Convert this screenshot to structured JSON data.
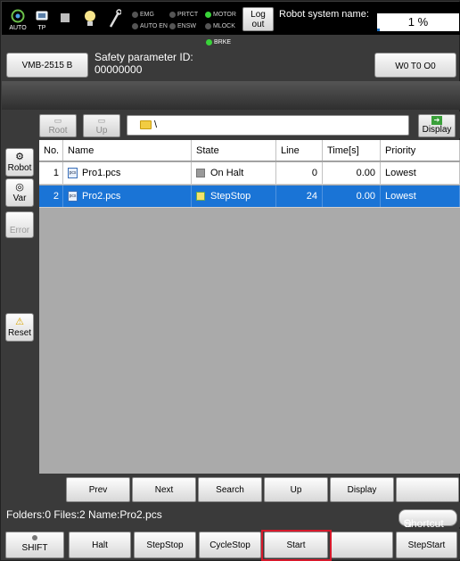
{
  "topbar": {
    "auto_label": "AUTO",
    "tp_label": "TP",
    "leds": [
      {
        "label": "EMG",
        "on": false
      },
      {
        "label": "PRTCT",
        "on": false
      },
      {
        "label": "MOTOR",
        "on": true
      },
      {
        "label": "AUTO EN",
        "on": false
      },
      {
        "label": "ENSW",
        "on": false
      },
      {
        "label": "MLOCK",
        "on": false
      }
    ],
    "logout_line1": "Log",
    "logout_line2": "out",
    "robot_system_name_label": "Robot system name:",
    "speed_percent": "1 %"
  },
  "brke_label": "BRKE",
  "header": {
    "model_button": "VMB-2515 B",
    "safety_label": "Safety parameter ID:",
    "safety_id": "00000000",
    "work_button": "W0 T0 O0"
  },
  "side": {
    "robot_label": "Robot",
    "var_label": "Var",
    "error_label": "Error",
    "reset_label": "Reset"
  },
  "file_toolbar": {
    "root_label": "Root",
    "up_label": "Up",
    "path": "\\",
    "display_label": "Display"
  },
  "table": {
    "columns": [
      "No.",
      "Name",
      "State",
      "Line",
      "Time[s]",
      "Priority"
    ],
    "rows": [
      {
        "no": "1",
        "name": "Pro1.pcs",
        "state": "On Halt",
        "line": "0",
        "time": "0.00",
        "priority": "Lowest",
        "selected": false
      },
      {
        "no": "2",
        "name": "Pro2.pcs",
        "state": "StepStop",
        "line": "24",
        "time": "0.00",
        "priority": "Lowest",
        "selected": true
      }
    ]
  },
  "nav_buttons": {
    "prev": "Prev",
    "next": "Next",
    "search": "Search",
    "up": "Up",
    "display": "Display"
  },
  "status": {
    "text": "Folders:0  Files:2  Name:Pro2.pcs",
    "shortcut": "Shortcut"
  },
  "action_bar": {
    "shift": "SHIFT",
    "halt": "Halt",
    "stepstop": "StepStop",
    "cyclestop": "CycleStop",
    "start": "Start",
    "stepstart": "StepStart"
  },
  "colors": {
    "selected_row": "#1a74d6",
    "highlight_frame": "#d8192b",
    "led_on": "#39d339"
  }
}
